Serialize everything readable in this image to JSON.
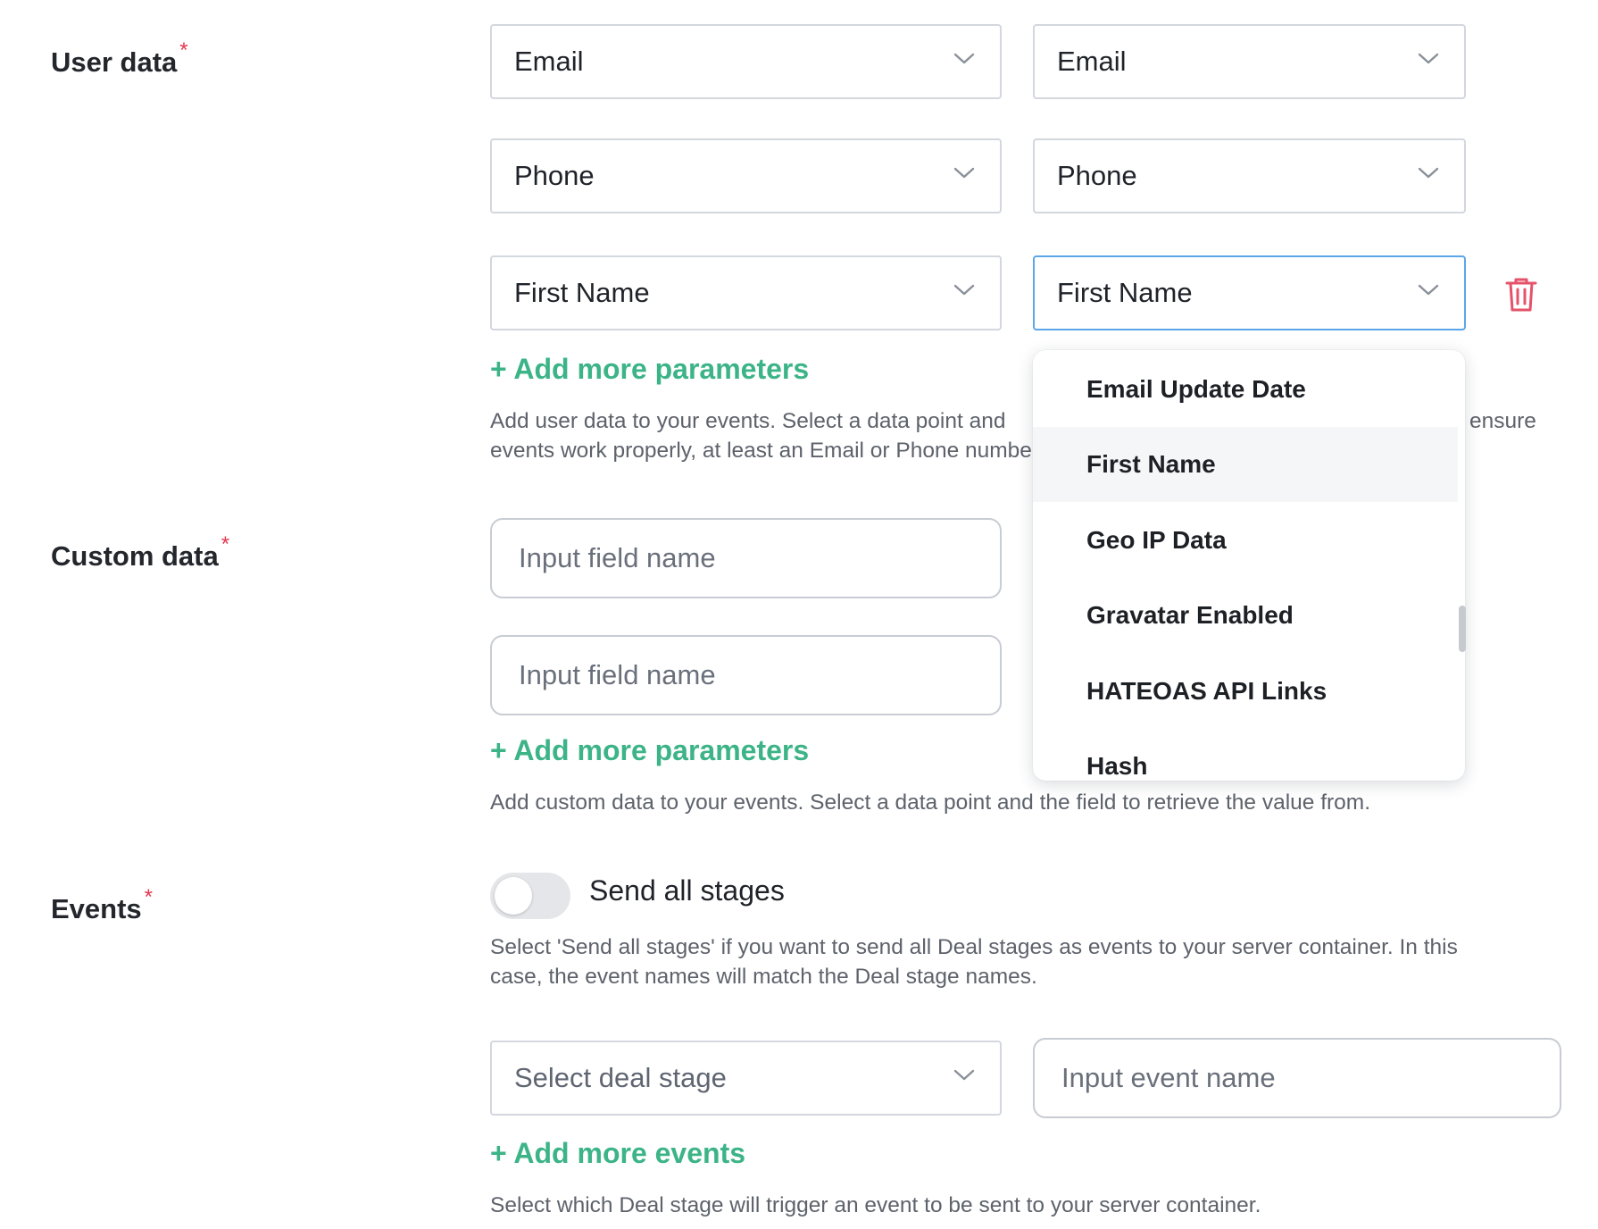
{
  "user_data": {
    "label": "User data",
    "required_mark": "*",
    "rows": [
      {
        "source": "Email",
        "target": "Email"
      },
      {
        "source": "Phone",
        "target": "Phone"
      },
      {
        "source": "First Name",
        "target": "First Name"
      }
    ],
    "add_link": "+ Add more parameters",
    "help_line1_left": "Add user data to your events. Select a data point and",
    "help_line1_right": "ensure",
    "help_line2_left": "events work properly, at least an Email or Phone number"
  },
  "dropdown": {
    "items": [
      "Email Update Date",
      "First Name",
      "Geo IP Data",
      "Gravatar Enabled",
      "HATEOAS API Links",
      "Hash"
    ],
    "highlighted": "First Name"
  },
  "custom_data": {
    "label": "Custom data",
    "required_mark": "*",
    "input_placeholder_1": "Input field name",
    "input_placeholder_2": "Input field name",
    "add_link": "+ Add more parameters",
    "help": "Add custom data to your events. Select a data point and the field to retrieve the value from."
  },
  "events": {
    "label": "Events",
    "required_mark": "*",
    "toggle_label": "Send all stages",
    "toggle_on": false,
    "help_line1": "Select 'Send all stages' if you want to send all Deal stages as events to your server container. In this",
    "help_line2": "case, the event names will match the Deal stage names.",
    "stage_placeholder": "Select deal stage",
    "event_name_placeholder": "Input event name",
    "add_link": "+ Add more events",
    "help_bottom": "Select which Deal stage will trigger an event to be sent to your server container."
  },
  "colors": {
    "accent_green": "#3cb487",
    "required_red": "#e5374c",
    "focus_blue": "#5ba6e9",
    "delete_red": "#e5536a"
  },
  "icons": {
    "select_arrow": "chevron-down-icon",
    "delete": "trash-icon"
  }
}
